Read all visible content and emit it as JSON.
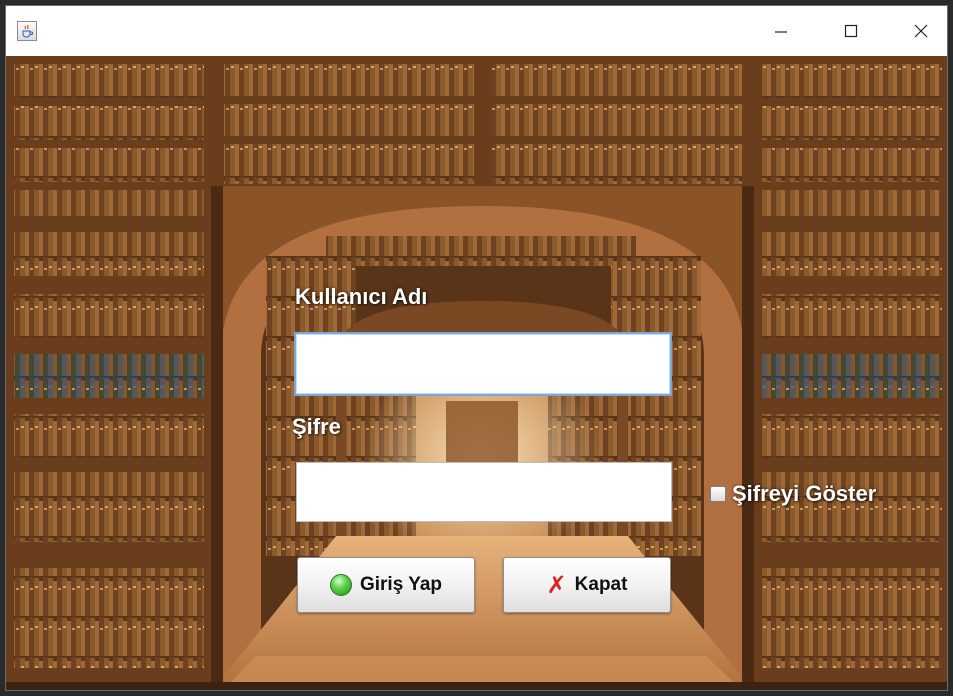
{
  "window": {
    "title": "",
    "controls": {
      "minimize": "─",
      "maximize": "☐",
      "close": "✕"
    }
  },
  "form": {
    "username_label": "Kullanıcı Adı",
    "username_value": "",
    "password_label": "Şifre",
    "password_value": "",
    "show_password_label": "Şifreyi Göster",
    "show_password_checked": false
  },
  "buttons": {
    "login_label": "Giriş Yap",
    "close_label": "Kapat"
  },
  "icons": {
    "app": "java-cup-icon",
    "login": "green-orb-icon",
    "close": "red-x-icon"
  },
  "colors": {
    "input_focus_border": "#7aa7d8",
    "close_icon": "#e0201b",
    "login_icon": "#5fd04e"
  }
}
